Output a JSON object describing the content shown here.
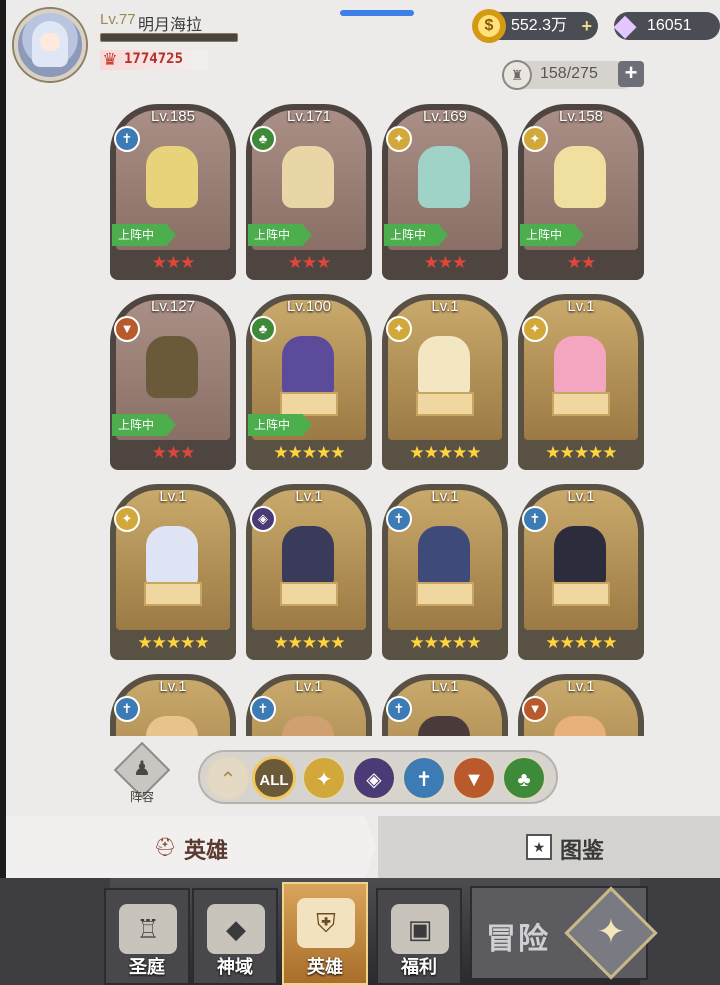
{
  "player": {
    "level": "Lv.77",
    "name": "明月海拉",
    "power": "1774725"
  },
  "currency": {
    "gold": "552.3万",
    "gems": "16051"
  },
  "capacity": "158/275",
  "heroes": [
    {
      "level": "Lv.185",
      "faction": "holy",
      "rarity": "red",
      "stars": "★★★",
      "deployed": true
    },
    {
      "level": "Lv.171",
      "faction": "nature",
      "rarity": "red",
      "stars": "★★★",
      "deployed": true
    },
    {
      "level": "Lv.169",
      "faction": "light",
      "rarity": "red",
      "stars": "★★★",
      "deployed": true
    },
    {
      "level": "Lv.158",
      "faction": "light",
      "rarity": "red",
      "stars": "★★",
      "deployed": true
    },
    {
      "level": "Lv.127",
      "faction": "beast",
      "rarity": "red",
      "stars": "★★★",
      "deployed": true
    },
    {
      "level": "Lv.100",
      "faction": "nature",
      "rarity": "gold",
      "stars": "★★★★★",
      "deployed": true
    },
    {
      "level": "Lv.1",
      "faction": "light",
      "rarity": "gold",
      "stars": "★★★★★",
      "deployed": false
    },
    {
      "level": "Lv.1",
      "faction": "light",
      "rarity": "gold",
      "stars": "★★★★★",
      "deployed": false
    },
    {
      "level": "Lv.1",
      "faction": "light",
      "rarity": "gold",
      "stars": "★★★★★",
      "deployed": false
    },
    {
      "level": "Lv.1",
      "faction": "dark",
      "rarity": "gold",
      "stars": "★★★★★",
      "deployed": false
    },
    {
      "level": "Lv.1",
      "faction": "holy",
      "rarity": "gold",
      "stars": "★★★★★",
      "deployed": false
    },
    {
      "level": "Lv.1",
      "faction": "holy",
      "rarity": "gold",
      "stars": "★★★★★",
      "deployed": false
    },
    {
      "level": "Lv.1",
      "faction": "holy",
      "rarity": "gold",
      "stars": "",
      "deployed": false
    },
    {
      "level": "Lv.1",
      "faction": "holy",
      "rarity": "gold",
      "stars": "",
      "deployed": false
    },
    {
      "level": "Lv.1",
      "faction": "holy",
      "rarity": "gold",
      "stars": "",
      "deployed": false
    },
    {
      "level": "Lv.1",
      "faction": "beast",
      "rarity": "gold",
      "stars": "",
      "deployed": false
    }
  ],
  "deployed_label": "上阵中",
  "lineup_label": "阵容",
  "filters": {
    "all_label": "ALL"
  },
  "tabs": {
    "heroes": "英雄",
    "codex": "图鉴"
  },
  "nav": {
    "items": [
      "圣庭",
      "神域",
      "英雄",
      "福利"
    ],
    "adventure": "冒险"
  },
  "colors": {
    "deployed_badge": "#4cae4c",
    "red_star": "#e0473b",
    "gold_star": "#ffd43d",
    "power_text": "#b2302a",
    "scroll_indicator": "#3d7fe6"
  }
}
